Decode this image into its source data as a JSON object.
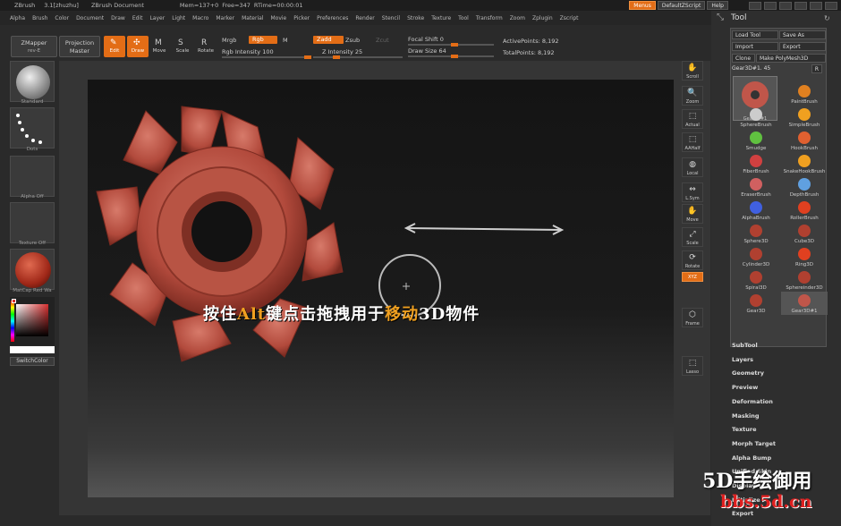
{
  "titlebar": {
    "app": "ZBrush",
    "version": "3.1[zhuzhu]",
    "doc": "ZBrush Document",
    "mem": "Mem=137+0",
    "free": "Free=347",
    "rtime": "RTime=00:00:01",
    "menus": "Menus",
    "script": "DefaultZScript",
    "help": "Help"
  },
  "menubar": [
    "Alpha",
    "Brush",
    "Color",
    "Document",
    "Draw",
    "Edit",
    "Layer",
    "Light",
    "Macro",
    "Marker",
    "Material",
    "Movie",
    "Picker",
    "Preferences",
    "Render",
    "Stencil",
    "Stroke",
    "Texture",
    "Tool",
    "Transform",
    "Zoom",
    "Zplugin",
    "Zscript"
  ],
  "toolbar": {
    "zmapper": "ZMapper",
    "zmapper_rev": "rev-E",
    "projection": "Projection",
    "projection_sub": "Master",
    "edit": "Edit",
    "draw": "Draw",
    "move": "Move",
    "scale": "Scale",
    "rotate": "Rotate",
    "mrgb": "Mrgb",
    "rgb": "Rgb",
    "m": "M",
    "rgb_intensity": "Rgb Intensity 100",
    "zadd": "Zadd",
    "zsub": "Zsub",
    "zcut": "Zcut",
    "z_intensity": "Z Intensity 25",
    "focal_shift": "Focal Shift 0",
    "draw_size": "Draw Size 64",
    "active_points": "ActivePoints: 8,192",
    "total_points": "TotalPoints: 8,192"
  },
  "leftshelf": {
    "standard": "Standard",
    "dots": "Dots",
    "alpha": "Alpha  Off",
    "texture": "Texture  Off",
    "matcap": "MatCap Red Wa",
    "switchcolor": "SwitchColor"
  },
  "rightshelf": [
    "Scroll",
    "Zoom",
    "Actual",
    "AAHalf",
    "Local",
    "L.Sym",
    "Move",
    "Scale",
    "Rotate",
    "XYZ",
    "Frame",
    "Lasso"
  ],
  "caption": {
    "pre": "按住",
    "key": "Alt",
    "mid": "键点击拖拽用于",
    "action": "移动",
    "post": "3D物件"
  },
  "toolpanel": {
    "title": "Tool",
    "load": "Load Tool",
    "save": "Save As",
    "import": "Import",
    "export": "Export",
    "clone": "Clone",
    "make_poly": "Make PolyMesh3D",
    "current": "Gear3D#1. 45",
    "r": "R",
    "current_thumb": "Gear3D#1",
    "brushes": [
      "PaintBrush",
      "SphereBrush",
      "SimpleBrush",
      "Smudge",
      "HookBrush",
      "FiberBrush",
      "SnakeHookBrush",
      "EraserBrush",
      "DepthBrush",
      "AlphaBrush",
      "RollerBrush",
      "Sphere3D",
      "Cube3D",
      "Cylinder3D",
      "Ring3D",
      "Spiral3D",
      "Sphereinder3D",
      "Gear3D",
      "Gear3D#1"
    ],
    "sections": [
      "SubTool",
      "Layers",
      "Geometry",
      "Preview",
      "Deformation",
      "Masking",
      "Texture",
      "Morph Target",
      "Alpha Bump",
      "Unified Skin",
      "Display",
      "Initialize",
      "Export"
    ]
  },
  "watermark": {
    "line1": "5D手绘御用",
    "line2": "bbs.5d.cn"
  },
  "colors": {
    "accent": "#e36d16",
    "gear": "#c0564a"
  }
}
